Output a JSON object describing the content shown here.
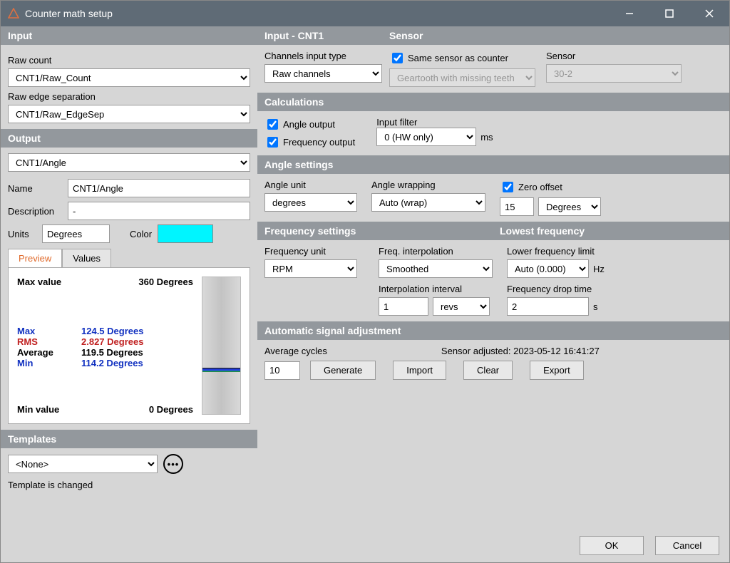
{
  "window": {
    "title": "Counter math setup"
  },
  "left": {
    "input_hdr": "Input",
    "raw_count_label": "Raw count",
    "raw_count_value": "CNT1/Raw_Count",
    "raw_edge_label": "Raw edge separation",
    "raw_edge_value": "CNT1/Raw_EdgeSep",
    "output_hdr": "Output",
    "output_select": "CNT1/Angle",
    "name_label": "Name",
    "name_value": "CNT1/Angle",
    "desc_label": "Description",
    "desc_value": "-",
    "units_label": "Units",
    "units_value": "Degrees",
    "color_label": "Color",
    "tab_preview": "Preview",
    "tab_values": "Values",
    "preview": {
      "max_value_label": "Max value",
      "max_value": "360 Degrees",
      "max_label": "Max",
      "max": "124.5 Degrees",
      "rms_label": "RMS",
      "rms": "2.827 Degrees",
      "avg_label": "Average",
      "avg": "119.5 Degrees",
      "min_label": "Min",
      "min": "114.2 Degrees",
      "min_value_label": "Min value",
      "min_value": "0 Degrees"
    },
    "templates_hdr": "Templates",
    "template_value": "<None>",
    "template_status": "Template is changed"
  },
  "right": {
    "input_cnt_hdr": "Input - CNT1",
    "sensor_hdr": "Sensor",
    "channels_label": "Channels input type",
    "channels_value": "Raw channels",
    "same_sensor_label": "Same sensor as counter",
    "sensor_type_label": "Sensor",
    "sensor_type_value": "Geartooth with missing teeth",
    "sensor_teeth_value": "30-2",
    "calc_hdr": "Calculations",
    "angle_output_label": "Angle output",
    "freq_output_label": "Frequency output",
    "input_filter_label": "Input filter",
    "input_filter_value": "0 (HW only)",
    "input_filter_unit": "ms",
    "angle_settings_hdr": "Angle settings",
    "angle_unit_label": "Angle unit",
    "angle_unit_value": "degrees",
    "angle_wrap_label": "Angle wrapping",
    "angle_wrap_value": "Auto (wrap)",
    "zero_offset_label": "Zero offset",
    "zero_offset_value": "15",
    "zero_offset_unit": "Degrees",
    "freq_settings_hdr": "Frequency settings",
    "lowest_freq_hdr": "Lowest frequency",
    "freq_unit_label": "Frequency unit",
    "freq_unit_value": "RPM",
    "freq_interp_label": "Freq. interpolation",
    "freq_interp_value": "Smoothed",
    "lower_limit_label": "Lower frequency limit",
    "lower_limit_value": "Auto (0.000)",
    "lower_limit_unit": "Hz",
    "interp_interval_label": "Interpolation interval",
    "interp_interval_value": "1",
    "interp_interval_unit": "revs",
    "freq_drop_label": "Frequency drop time",
    "freq_drop_value": "2",
    "freq_drop_unit": "s",
    "auto_adj_hdr": "Automatic signal adjustment",
    "avg_cycles_label": "Average cycles",
    "avg_cycles_value": "10",
    "sensor_adjusted": "Sensor adjusted: 2023-05-12 16:41:27",
    "btn_generate": "Generate",
    "btn_import": "Import",
    "btn_clear": "Clear",
    "btn_export": "Export"
  },
  "footer": {
    "ok": "OK",
    "cancel": "Cancel"
  }
}
